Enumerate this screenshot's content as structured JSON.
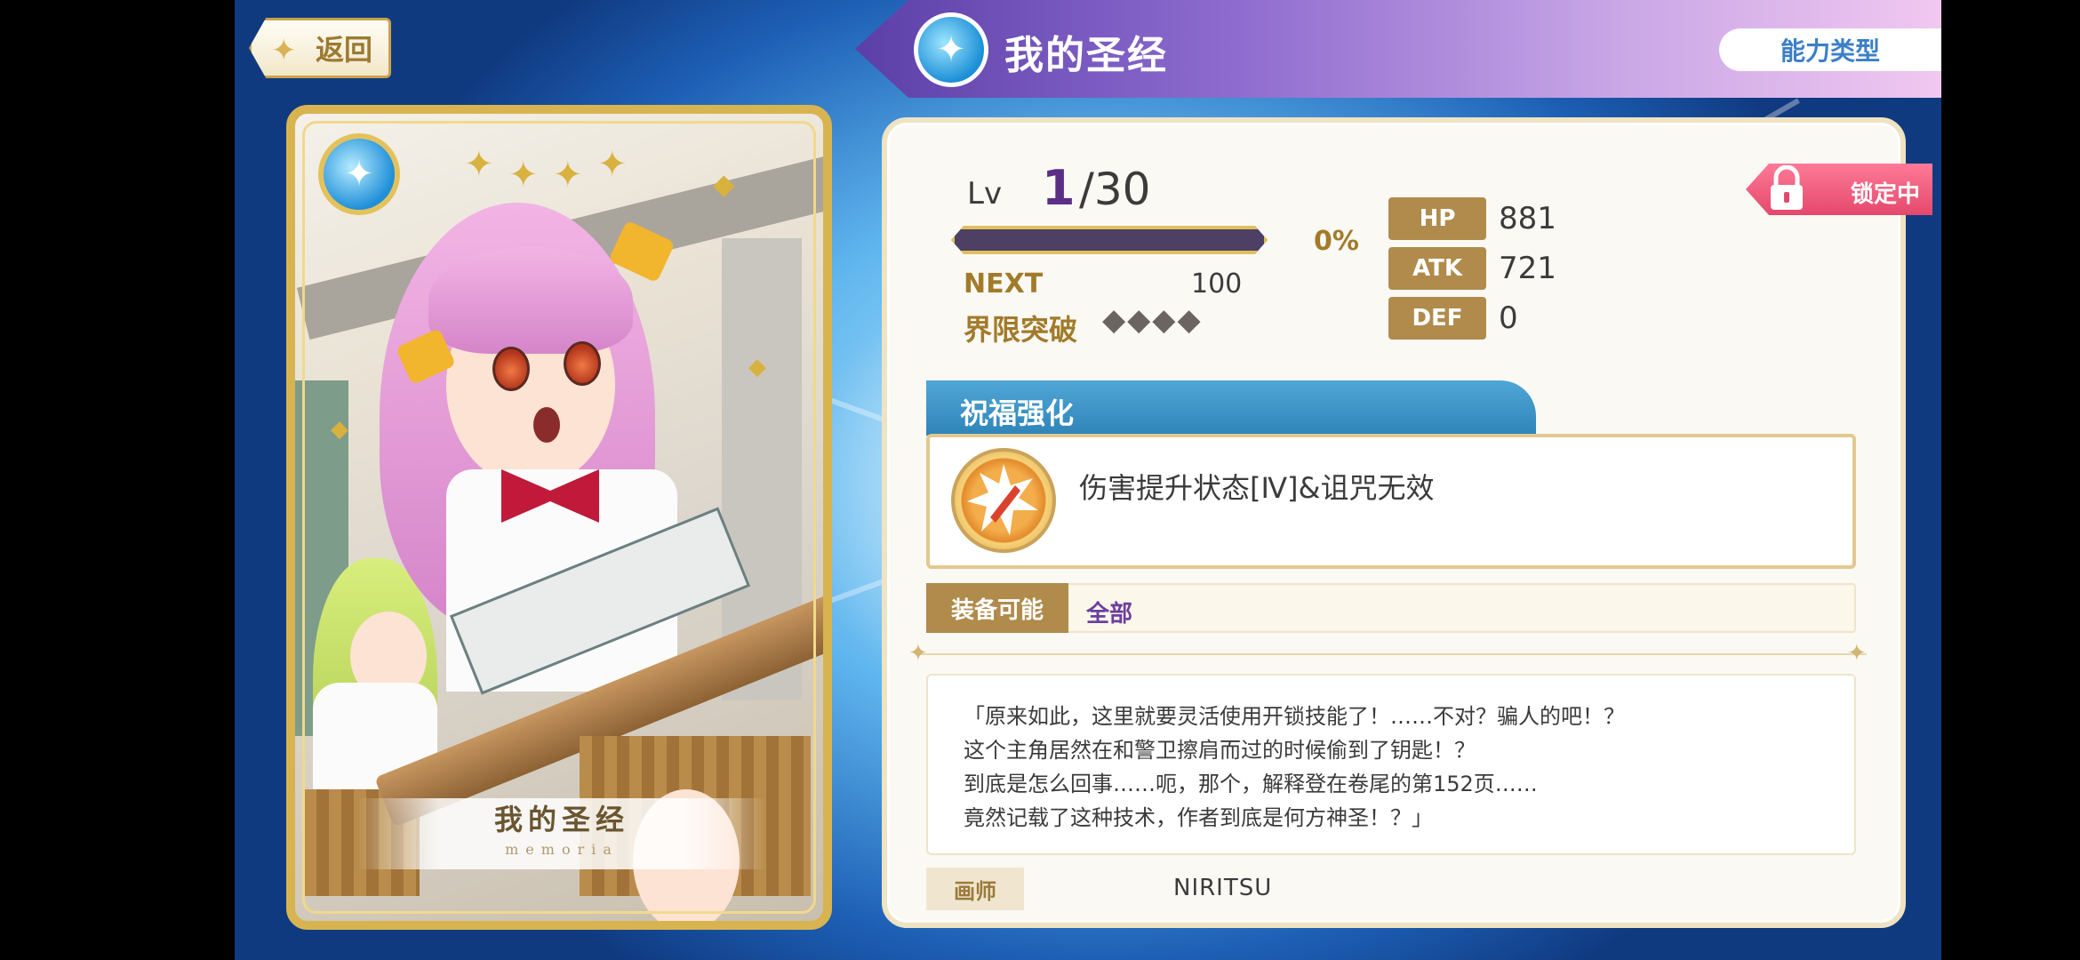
{
  "header": {
    "back_label": "返回",
    "title": "我的圣经",
    "ability_button": "能力类型"
  },
  "card": {
    "name": "我的圣经",
    "subtitle": "memoria"
  },
  "level": {
    "label": "Lv",
    "current": "1",
    "max": "/30",
    "exp_progress": 0,
    "exp_percent": "0%",
    "next_label": "NEXT",
    "next_value": "100",
    "limit_break_label": "界限突破",
    "limit_break_marks": "◆◆◆◆"
  },
  "stats": [
    {
      "label": "HP",
      "value": "881"
    },
    {
      "label": "ATK",
      "value": "721"
    },
    {
      "label": "DEF",
      "value": "0"
    }
  ],
  "lock": {
    "label": "锁定中"
  },
  "blessing": {
    "title": "祝福强化",
    "effect": "伤害提升状态[Ⅳ]&诅咒无效"
  },
  "equip": {
    "label": "装备可能",
    "value": "全部"
  },
  "description": [
    "「原来如此，这里就要灵活使用开锁技能了！……不对？骗人的吧！？",
    "这个主角居然在和警卫擦肩而过的时候偷到了钥匙！？",
    "到底是怎么回事……呃，那个，解释登在卷尾的第152页……",
    "竟然记载了这种技术，作者到底是何方神圣！？」"
  ],
  "artist": {
    "label": "画师",
    "name": "NIRITSU"
  },
  "colors": {
    "gold": "#b08b4c",
    "blessing_blue": "#2f84b8",
    "lock_pink": "#e4486d",
    "level_purple": "#5a2f85"
  }
}
